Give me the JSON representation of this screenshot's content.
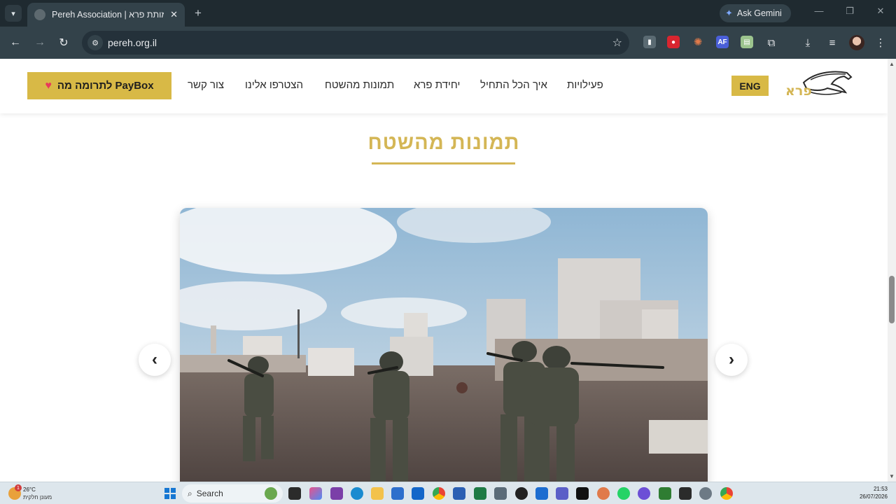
{
  "browser": {
    "tab": {
      "title": "Pereh Association | עמותת פרא"
    },
    "address": "pereh.org.il",
    "gemini_label": "Ask Gemini"
  },
  "site": {
    "donate_label": "לתרומה מה PayBox",
    "nav": [
      {
        "label": "פעילויות"
      },
      {
        "label": "איך הכל התחיל"
      },
      {
        "label": "יחידת פרא"
      },
      {
        "label": "תמונות מהשטח"
      },
      {
        "label": "הצטרפו אלינו"
      },
      {
        "label": "צור קשר"
      }
    ],
    "lang_button": "ENG",
    "logo_text": "פרא",
    "section_title": "תמונות מהשטח",
    "carousel": {
      "prev": "‹",
      "next": "›"
    }
  },
  "taskbar": {
    "weather_temp": "26°C",
    "weather_condition": "מעונן חלקית",
    "weather_badge": "1",
    "search_label": "Search",
    "time": "21:53",
    "date": "26/07/2026"
  },
  "colors": {
    "accent_gold": "#d8b946",
    "title_gold": "#d4b655",
    "browser_dark": "#33424a"
  }
}
